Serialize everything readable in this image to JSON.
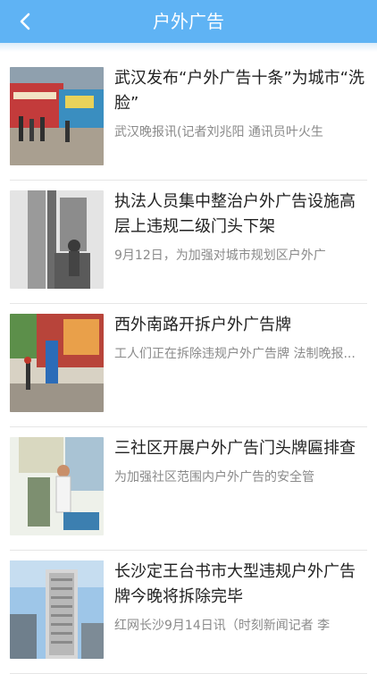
{
  "header": {
    "title": "户外广告",
    "back_icon": "chevron-left-icon"
  },
  "articles": [
    {
      "headline": "武汉发布“户外广告十条”为城市“洗脸”",
      "summary": "武汉晚报讯(记者刘兆阳 通讯员叶火生"
    },
    {
      "headline": "执法人员集中整治户外广告设施高层上违规二级门头下架",
      "summary": "9月12日，为加强对城市规划区户外广"
    },
    {
      "headline": "西外南路开拆户外广告牌",
      "summary": "工人们正在拆除违规户外广告牌 法制晚报..."
    },
    {
      "headline": "三社区开展户外广告门头牌匾排查",
      "summary": "为加强社区范围内户外广告的安全管"
    },
    {
      "headline": "长沙定王台书市大型违规户外广告牌今晚将拆除完毕",
      "summary": "红网长沙9月14日讯（时刻新闻记者 李"
    }
  ]
}
